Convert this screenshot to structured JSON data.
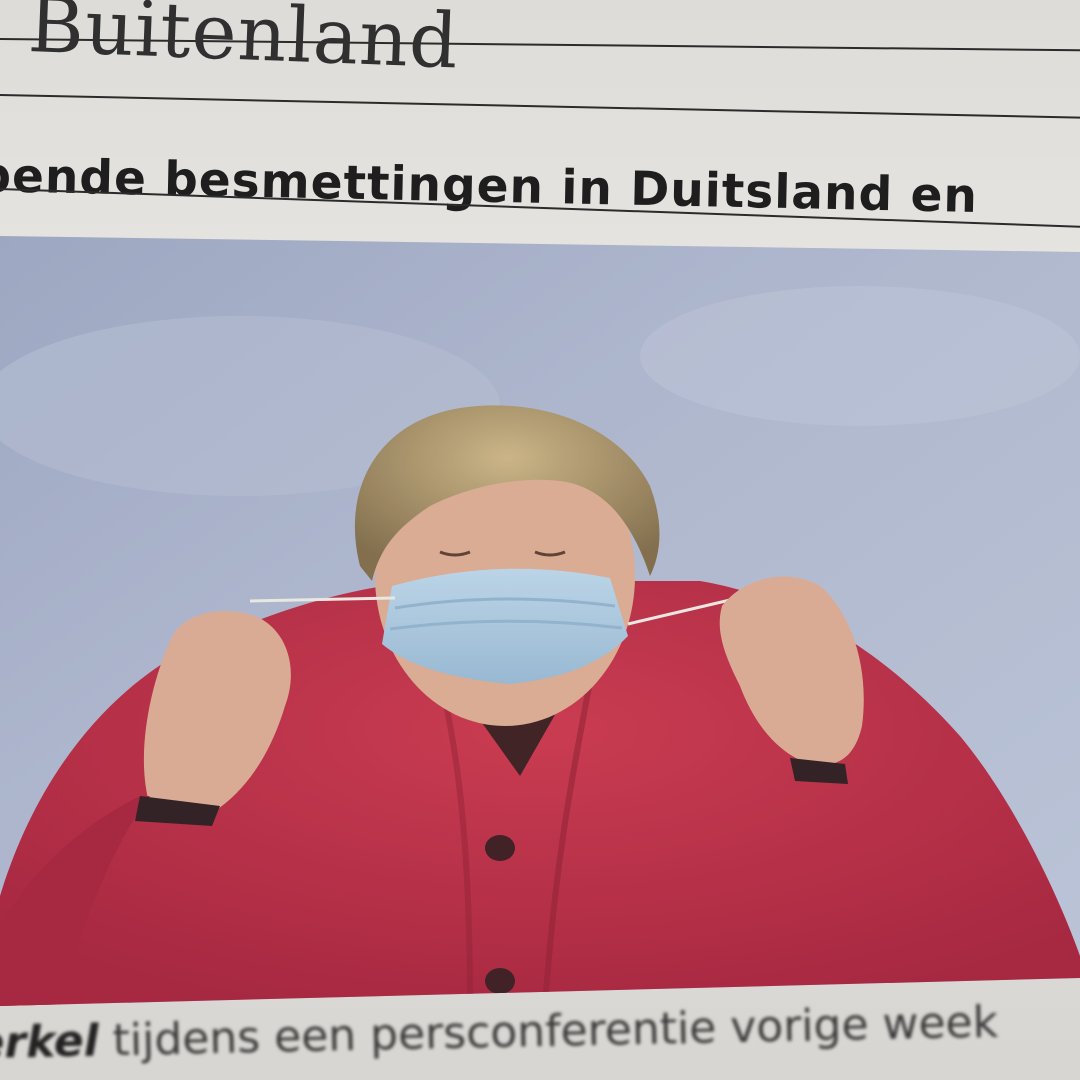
{
  "newspaper": {
    "section_title": "Buitenland",
    "headline": "pende besmettingen in Duitsland en",
    "caption": {
      "name": "erkel",
      "text": "tijdens een persconferentie vorige week"
    }
  },
  "photo": {
    "subject": "person-adjusting-face-mask",
    "colors": {
      "sky": "#a9b3cc",
      "jacket": "#b8283e",
      "mask": "#a8c7df",
      "hair": "#b59c6c",
      "skin": "#d8a98f"
    }
  }
}
